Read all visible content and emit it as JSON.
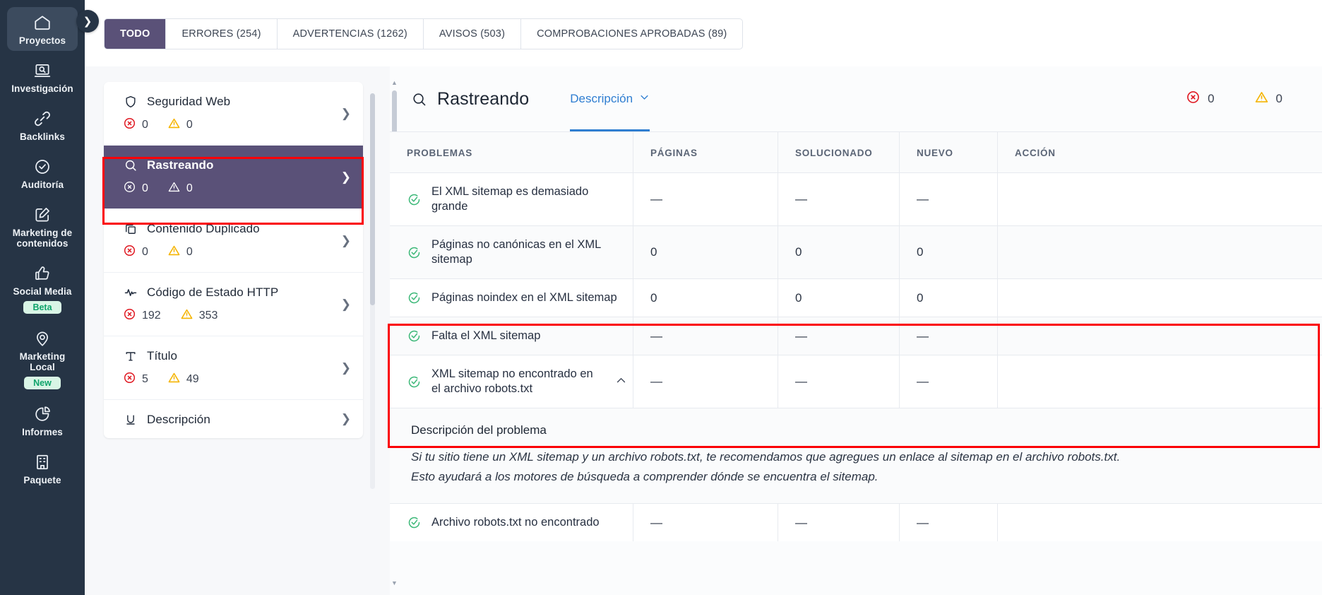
{
  "rail": {
    "items": [
      {
        "label": "Proyectos",
        "icon": "home-icon",
        "active": true,
        "badge": ""
      },
      {
        "label": "Investigación",
        "icon": "research-icon",
        "active": false,
        "badge": ""
      },
      {
        "label": "Backlinks",
        "icon": "link-icon",
        "active": false,
        "badge": ""
      },
      {
        "label": "Auditoría",
        "icon": "check-circle-icon",
        "active": false,
        "badge": ""
      },
      {
        "label": "Marketing de contenidos",
        "icon": "edit-square-icon",
        "active": false,
        "badge": ""
      },
      {
        "label": "Social Media",
        "icon": "thumbs-up-icon",
        "active": false,
        "badge": "Beta"
      },
      {
        "label": "Marketing Local",
        "icon": "map-pin-icon",
        "active": false,
        "badge": "New"
      },
      {
        "label": "Informes",
        "icon": "pie-chart-icon",
        "active": false,
        "badge": ""
      },
      {
        "label": "Paquete",
        "icon": "building-icon",
        "active": false,
        "badge": ""
      }
    ],
    "collapse_icon": "chevron-right-icon"
  },
  "tabs": [
    {
      "label": "TODO",
      "active": true
    },
    {
      "label": "ERRORES (254)",
      "active": false
    },
    {
      "label": "ADVERTENCIAS (1262)",
      "active": false
    },
    {
      "label": "AVISOS (503)",
      "active": false
    },
    {
      "label": "COMPROBACIONES APROBADAS (89)",
      "active": false
    }
  ],
  "categories": [
    {
      "title": "Seguridad Web",
      "icon": "shield-icon",
      "errors": "0",
      "warnings": "0",
      "selected": false
    },
    {
      "title": "Rastreando",
      "icon": "search-icon",
      "errors": "0",
      "warnings": "0",
      "selected": true
    },
    {
      "title": "Contenido Duplicado",
      "icon": "copy-icon",
      "errors": "0",
      "warnings": "0",
      "selected": false
    },
    {
      "title": "Código de Estado HTTP",
      "icon": "activity-icon",
      "errors": "192",
      "warnings": "353",
      "selected": false
    },
    {
      "title": "Título",
      "icon": "text-t-icon",
      "errors": "5",
      "warnings": "49",
      "selected": false
    },
    {
      "title": "Descripción",
      "icon": "underline-u-icon",
      "errors": "",
      "warnings": "",
      "selected": false
    }
  ],
  "main": {
    "title": "Rastreando",
    "title_icon": "search-icon",
    "tab_label": "Descripción",
    "tab_chevron": "chevron-down-icon",
    "errors_count": "0",
    "warnings_count": "0",
    "columns": [
      "PROBLEMAS",
      "PÁGINAS",
      "SOLUCIONADO",
      "NUEVO",
      "ACCIÓN"
    ],
    "rows": [
      {
        "name": "El XML sitemap es demasiado grande",
        "status": "check-circle-green",
        "paginas": "—",
        "solucionado": "—",
        "nuevo": "—",
        "accion": "",
        "expanded": false
      },
      {
        "name": "Páginas no canónicas en el XML sitemap",
        "status": "check-circle-green",
        "paginas": "0",
        "solucionado": "0",
        "nuevo": "0",
        "accion": "",
        "expanded": false
      },
      {
        "name": "Páginas noindex en el XML sitemap",
        "status": "check-circle-green",
        "paginas": "0",
        "solucionado": "0",
        "nuevo": "0",
        "accion": "",
        "expanded": false
      },
      {
        "name": "Falta el XML sitemap",
        "status": "check-circle-green",
        "paginas": "—",
        "solucionado": "—",
        "nuevo": "—",
        "accion": "",
        "expanded": false
      },
      {
        "name": "XML sitemap no encontrado en el archivo robots.txt",
        "status": "check-circle-green",
        "paginas": "—",
        "solucionado": "—",
        "nuevo": "—",
        "accion": "",
        "expanded": true
      },
      {
        "name": "Archivo robots.txt no encontrado",
        "status": "check-circle-green",
        "paginas": "—",
        "solucionado": "—",
        "nuevo": "—",
        "accion": "",
        "expanded": false
      }
    ],
    "description": {
      "heading": "Descripción del problema",
      "text": "Si tu sitio tiene un XML sitemap y un archivo robots.txt, te recomendamos que agregues un enlace al sitemap en el archivo robots.txt. Esto ayudará a los motores de búsqueda a comprender dónde se encuentra el sitemap."
    }
  },
  "colors": {
    "rail_bg": "#263445",
    "accent_purple": "#5a5178",
    "link_blue": "#2f7ed1",
    "error_red": "#e01b24",
    "warning_yellow": "#f5b400",
    "success_green": "#3cb878",
    "highlight_red": "#fb0007"
  }
}
